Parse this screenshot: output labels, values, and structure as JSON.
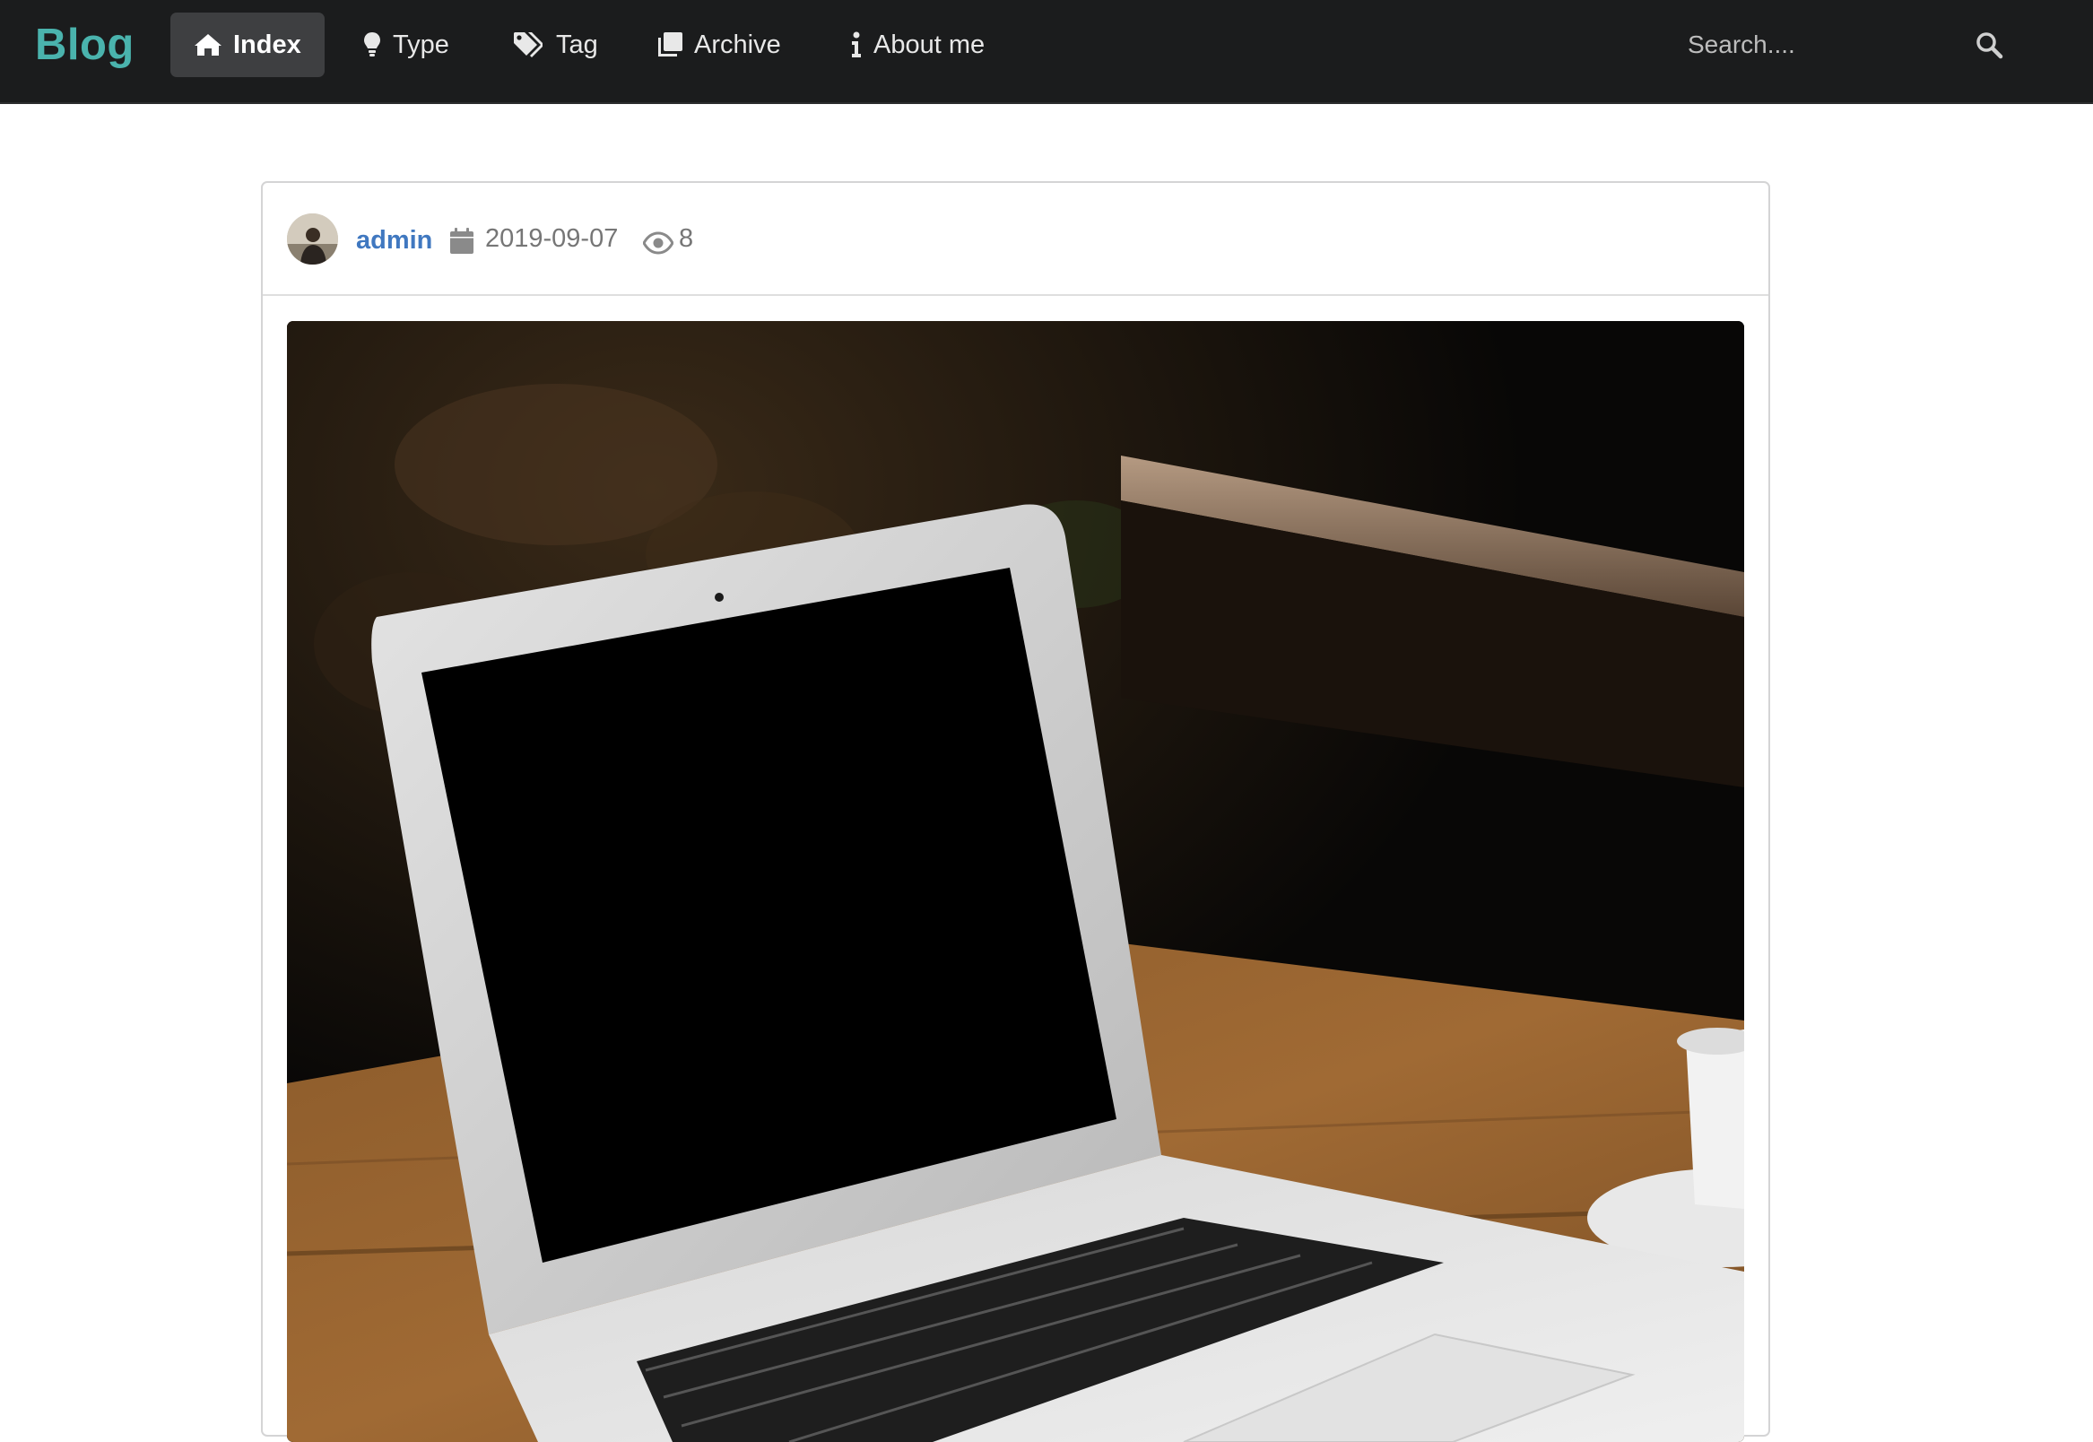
{
  "navbar": {
    "brand": "Blog",
    "brand_color": "#4ab3ad",
    "items": [
      {
        "label": "Index",
        "icon": "home-icon",
        "active": true
      },
      {
        "label": "Type",
        "icon": "lightbulb-icon",
        "active": false
      },
      {
        "label": "Tag",
        "icon": "tags-icon",
        "active": false
      },
      {
        "label": "Archive",
        "icon": "clone-icon",
        "active": false
      },
      {
        "label": "About me",
        "icon": "info-icon",
        "active": false
      }
    ],
    "search": {
      "placeholder": "Search....",
      "icon": "search-icon"
    }
  },
  "post": {
    "author": "admin",
    "author_color": "#4078c0",
    "date": "2019-09-07",
    "views": "8",
    "date_icon": "calendar-icon",
    "views_icon": "eye-icon",
    "cover_image": "laptop-on-wooden-table-photo"
  }
}
